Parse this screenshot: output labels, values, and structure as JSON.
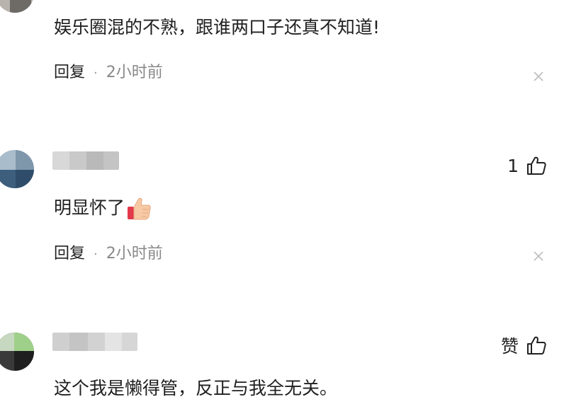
{
  "comments": [
    {
      "text": "娱乐圈混的不熟，跟谁两口子还真不知道!",
      "reply_label": "回复",
      "separator": "·",
      "time": "2小时前"
    },
    {
      "text": "明显怀了",
      "reply_label": "回复",
      "separator": "·",
      "time": "2小时前",
      "like_count": "1"
    },
    {
      "text": "这个我是懒得管，反正与我全无关。",
      "like_label": "赞"
    }
  ],
  "icons": {
    "like": "thumbs-up-outline-icon",
    "close": "close-x-icon",
    "emoji": "thumbs-up-emoji-icon"
  },
  "colors": {
    "time_gray": "#888888",
    "close_gray": "#bbbbbb"
  }
}
